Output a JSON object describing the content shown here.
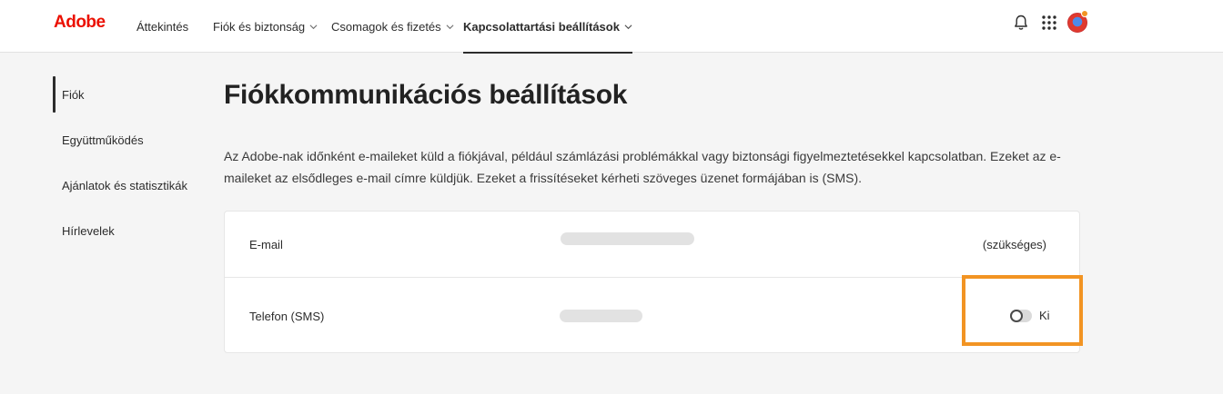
{
  "header": {
    "logo": "Adobe",
    "nav": [
      {
        "label": "Áttekintés",
        "has_dropdown": false
      },
      {
        "label": "Fiók és biztonság",
        "has_dropdown": true
      },
      {
        "label": "Csomagok és fizetés",
        "has_dropdown": true
      },
      {
        "label": "Kapcsolattartási beállítások",
        "has_dropdown": true,
        "active": true
      }
    ],
    "icons": [
      "bell-icon",
      "app-grid-icon",
      "avatar"
    ]
  },
  "sidebar": {
    "items": [
      {
        "label": "Fiók",
        "active": true
      },
      {
        "label": "Együttműködés"
      },
      {
        "label": "Ajánlatok és statisztikák"
      },
      {
        "label": "Hírlevelek"
      }
    ]
  },
  "main": {
    "title": "Fiókkommunikációs beállítások",
    "description": "Az Adobe-nak időnként e-maileket küld a fiókjával, például számlázási problémákkal vagy biztonsági figyelmeztetésekkel kapcsolatban. Ezeket az e-maileket az elsődleges e-mail címre küldjük. Ezeket a frissítéseket kérheti szöveges üzenet formájában is (SMS).",
    "rows": [
      {
        "label": "E-mail",
        "status": "(szükséges)"
      },
      {
        "label": "Telefon (SMS)",
        "toggle_label": "Ki",
        "toggle_on": false
      }
    ]
  },
  "colors": {
    "brand": "#eb1000",
    "highlight": "#f29423"
  }
}
